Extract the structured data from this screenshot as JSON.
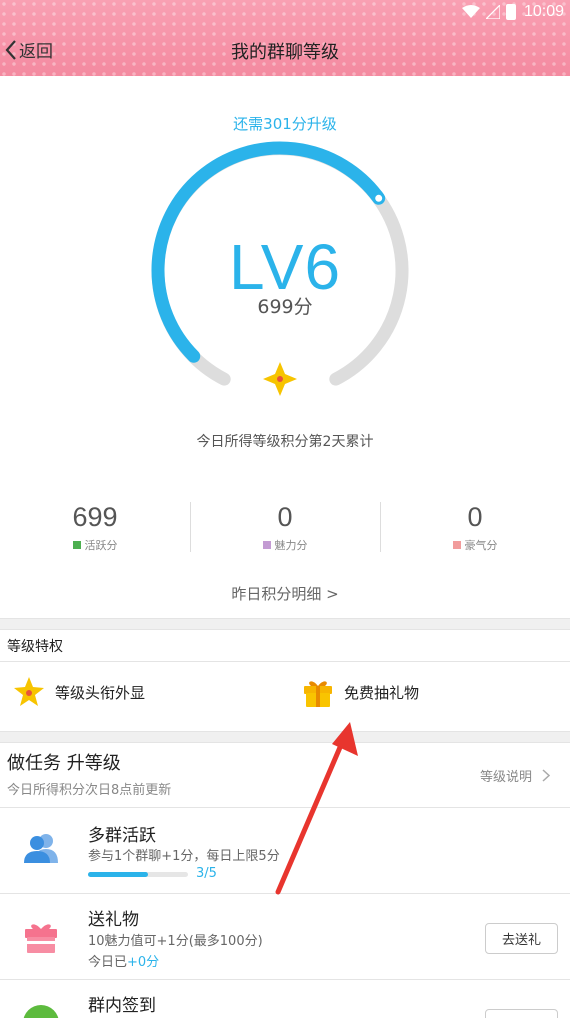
{
  "status": {
    "time": "10:09"
  },
  "header": {
    "back_label": "返回",
    "title": "我的群聊等级"
  },
  "gauge": {
    "need_text": "还需301分升级",
    "level": "LV6",
    "score_text": "699分",
    "note": "今日所得等级积分第2天累计",
    "progress_fraction": 0.7,
    "colors": {
      "accent": "#2bb3ea",
      "track": "#dddddd",
      "star": "#f7c400"
    }
  },
  "stats": [
    {
      "value": "699",
      "label": "活跃分",
      "color": "#4caf50"
    },
    {
      "value": "0",
      "label": "魅力分",
      "color": "#c39bd3"
    },
    {
      "value": "0",
      "label": "豪气分",
      "color": "#f19c9c"
    }
  ],
  "yesterday_link": "昨日积分明细 >",
  "privileges": {
    "title": "等级特权",
    "items": [
      {
        "label": "等级头衔外显",
        "icon": "star-badge-icon"
      },
      {
        "label": "免费抽礼物",
        "icon": "gift-box-icon"
      }
    ]
  },
  "tasks": {
    "title": "做任务 升等级",
    "subtitle": "今日所得积分次日8点前更新",
    "explain_link": "等级说明",
    "items": [
      {
        "name": "多群活跃",
        "desc": "参与1个群聊+1分，每日上限5分",
        "progress_text": "3/5",
        "progress_fraction": 0.6,
        "icon": "users-icon"
      },
      {
        "name": "送礼物",
        "desc": "10魅力值可+1分(最多100分)",
        "today_prefix": "今日已",
        "today_value": "+0分",
        "button": "去送礼",
        "icon": "gift-icon"
      },
      {
        "name": "群内签到",
        "icon": "checkin-icon"
      }
    ]
  }
}
